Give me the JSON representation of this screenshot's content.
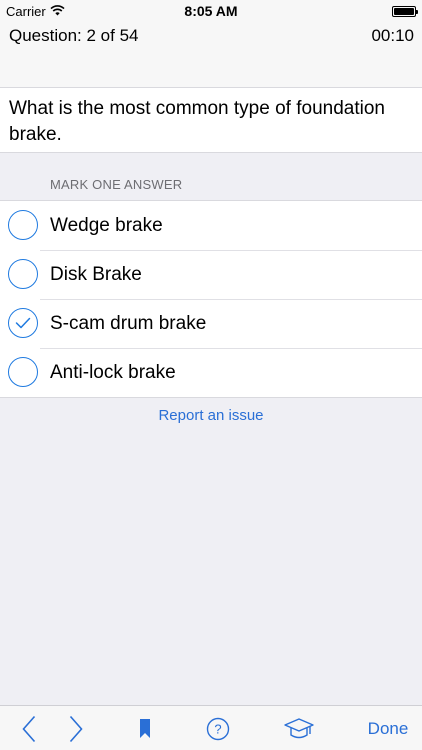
{
  "status_bar": {
    "carrier": "Carrier",
    "time": "8:05 AM"
  },
  "header": {
    "question_counter": "Question: 2 of 54",
    "timer": "00:10"
  },
  "question": {
    "text": "What is the most common type of foundation brake."
  },
  "answers_section": {
    "label": "MARK ONE ANSWER",
    "options": [
      {
        "label": "Wedge brake",
        "checked": false
      },
      {
        "label": "Disk Brake",
        "checked": false
      },
      {
        "label": "S-cam drum brake",
        "checked": true
      },
      {
        "label": "Anti-lock brake",
        "checked": false
      }
    ]
  },
  "report_link": "Report an issue",
  "toolbar": {
    "items": [
      "back-icon",
      "forward-icon",
      "bookmark-icon",
      "help-icon",
      "graduation-cap-icon"
    ],
    "done_label": "Done"
  },
  "colors": {
    "accent": "#1f7ae0",
    "link": "#2a6fd6",
    "background": "#efeff4",
    "bar_background": "#f7f7f7"
  }
}
